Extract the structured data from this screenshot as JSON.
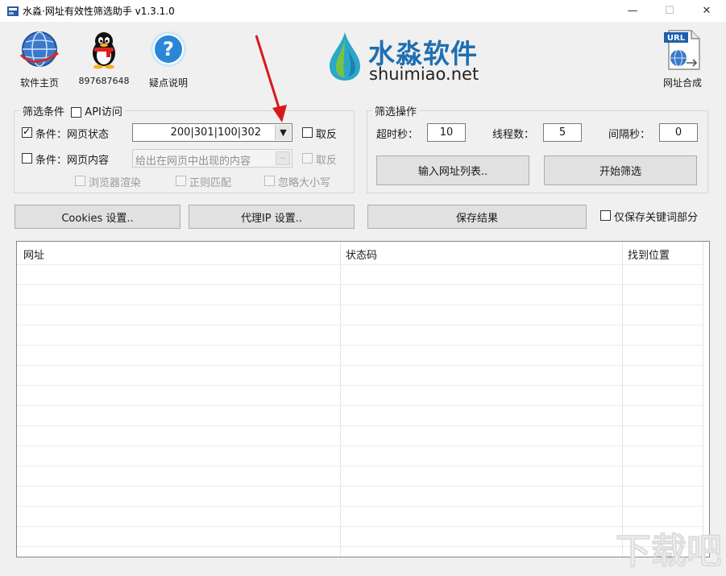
{
  "window": {
    "title": "水淼·网址有效性筛选助手 v1.3.1.0",
    "controls": {
      "minimize": "—",
      "maximize": "☐",
      "close": "✕"
    }
  },
  "toolbar": {
    "home_label": "软件主页",
    "qq_label": "897687648",
    "help_label": "疑点说明",
    "url_merge_label": "网址合成",
    "url_badge": "URL"
  },
  "logo": {
    "cn": "水淼软件",
    "en": "shuimiao.net"
  },
  "filter_conditions": {
    "group_label": "筛选条件",
    "api_label": "API访问",
    "api_checked": false,
    "status_condition": {
      "checked": true,
      "label": "条件：网页状态",
      "value": "200|301|100|302",
      "invert_label": "取反",
      "invert_checked": false
    },
    "content_condition": {
      "checked": false,
      "label": "条件：网页内容",
      "placeholder": "给出在网页中出现的内容",
      "browse_label": "..",
      "invert_label": "取反"
    },
    "options": {
      "browser_render": "浏览器渲染",
      "regex_match": "正则匹配",
      "ignore_case": "忽略大小写"
    }
  },
  "filter_operations": {
    "group_label": "筛选操作",
    "timeout_label": "超时秒：",
    "timeout_value": "10",
    "threads_label": "线程数：",
    "threads_value": "5",
    "interval_label": "间隔秒：",
    "interval_value": "0",
    "input_urls_button": "输入网址列表..",
    "start_button": "开始筛选"
  },
  "actions": {
    "cookies_button": "Cookies 设置..",
    "proxy_button": "代理IP 设置..",
    "save_button": "保存结果",
    "keywords_only_label": "仅保存关键词部分",
    "keywords_only_checked": false
  },
  "results_table": {
    "columns": [
      "网址",
      "状态码",
      "找到位置"
    ],
    "rows": []
  },
  "watermark": {
    "text": "下载吧"
  },
  "colors": {
    "logo_blue": "#1f6fb2",
    "drop_teal": "#2aa7c9",
    "drop_green": "#7cc242",
    "red_arrow": "#d7191c"
  }
}
